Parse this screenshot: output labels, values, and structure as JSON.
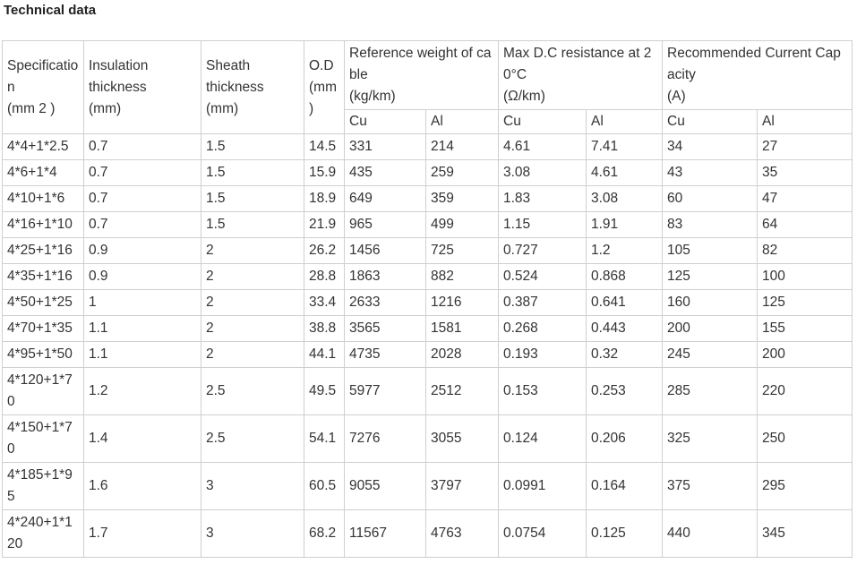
{
  "title": "Technical data",
  "headers": {
    "spec": "Specification\n(mm 2 )",
    "insulation": "Insulation\nthickness\n(mm)",
    "sheath": "Sheath\nthickness\n(mm)",
    "od": "O.D\n(mm\n)",
    "weight": "Reference weight of cable\n(kg/km)",
    "resistance": "Max D.C resistance at 20°C\n(Ω/km)",
    "current": "Recommended Current Capacity\n(A)",
    "cu": "Cu",
    "al": "Al"
  },
  "rows": [
    [
      "4*4+1*2.5",
      "0.7",
      "1.5",
      "14.5",
      "331",
      "214",
      "4.61",
      "7.41",
      "34",
      "27"
    ],
    [
      "4*6+1*4",
      "0.7",
      "1.5",
      "15.9",
      "435",
      "259",
      "3.08",
      "4.61",
      "43",
      "35"
    ],
    [
      "4*10+1*6",
      "0.7",
      "1.5",
      "18.9",
      "649",
      "359",
      "1.83",
      "3.08",
      "60",
      "47"
    ],
    [
      "4*16+1*10",
      "0.7",
      "1.5",
      "21.9",
      "965",
      "499",
      "1.15",
      "1.91",
      "83",
      "64"
    ],
    [
      "4*25+1*16",
      "0.9",
      "2",
      "26.2",
      "1456",
      "725",
      "0.727",
      "1.2",
      "105",
      "82"
    ],
    [
      "4*35+1*16",
      "0.9",
      "2",
      "28.8",
      "1863",
      "882",
      "0.524",
      "0.868",
      "125",
      "100"
    ],
    [
      "4*50+1*25",
      "1",
      "2",
      "33.4",
      "2633",
      "1216",
      "0.387",
      "0.641",
      "160",
      "125"
    ],
    [
      "4*70+1*35",
      "1.1",
      "2",
      "38.8",
      "3565",
      "1581",
      "0.268",
      "0.443",
      "200",
      "155"
    ],
    [
      "4*95+1*50",
      "1.1",
      "2",
      "44.1",
      "4735",
      "2028",
      "0.193",
      "0.32",
      "245",
      "200"
    ],
    [
      "4*120+1*70",
      "1.2",
      "2.5",
      "49.5",
      "5977",
      "2512",
      "0.153",
      "0.253",
      "285",
      "220"
    ],
    [
      "4*150+1*70",
      "1.4",
      "2.5",
      "54.1",
      "7276",
      "3055",
      "0.124",
      "0.206",
      "325",
      "250"
    ],
    [
      "4*185+1*95",
      "1.6",
      "3",
      "60.5",
      "9055",
      "3797",
      "0.0991",
      "0.164",
      "375",
      "295"
    ],
    [
      "4*240+1*120",
      "1.7",
      "3",
      "68.2",
      "11567",
      "4763",
      "0.0754",
      "0.125",
      "440",
      "345"
    ]
  ],
  "colors": {
    "border": "#cfcfcf",
    "text": "#333333",
    "title": "#222222",
    "background": "#ffffff"
  }
}
